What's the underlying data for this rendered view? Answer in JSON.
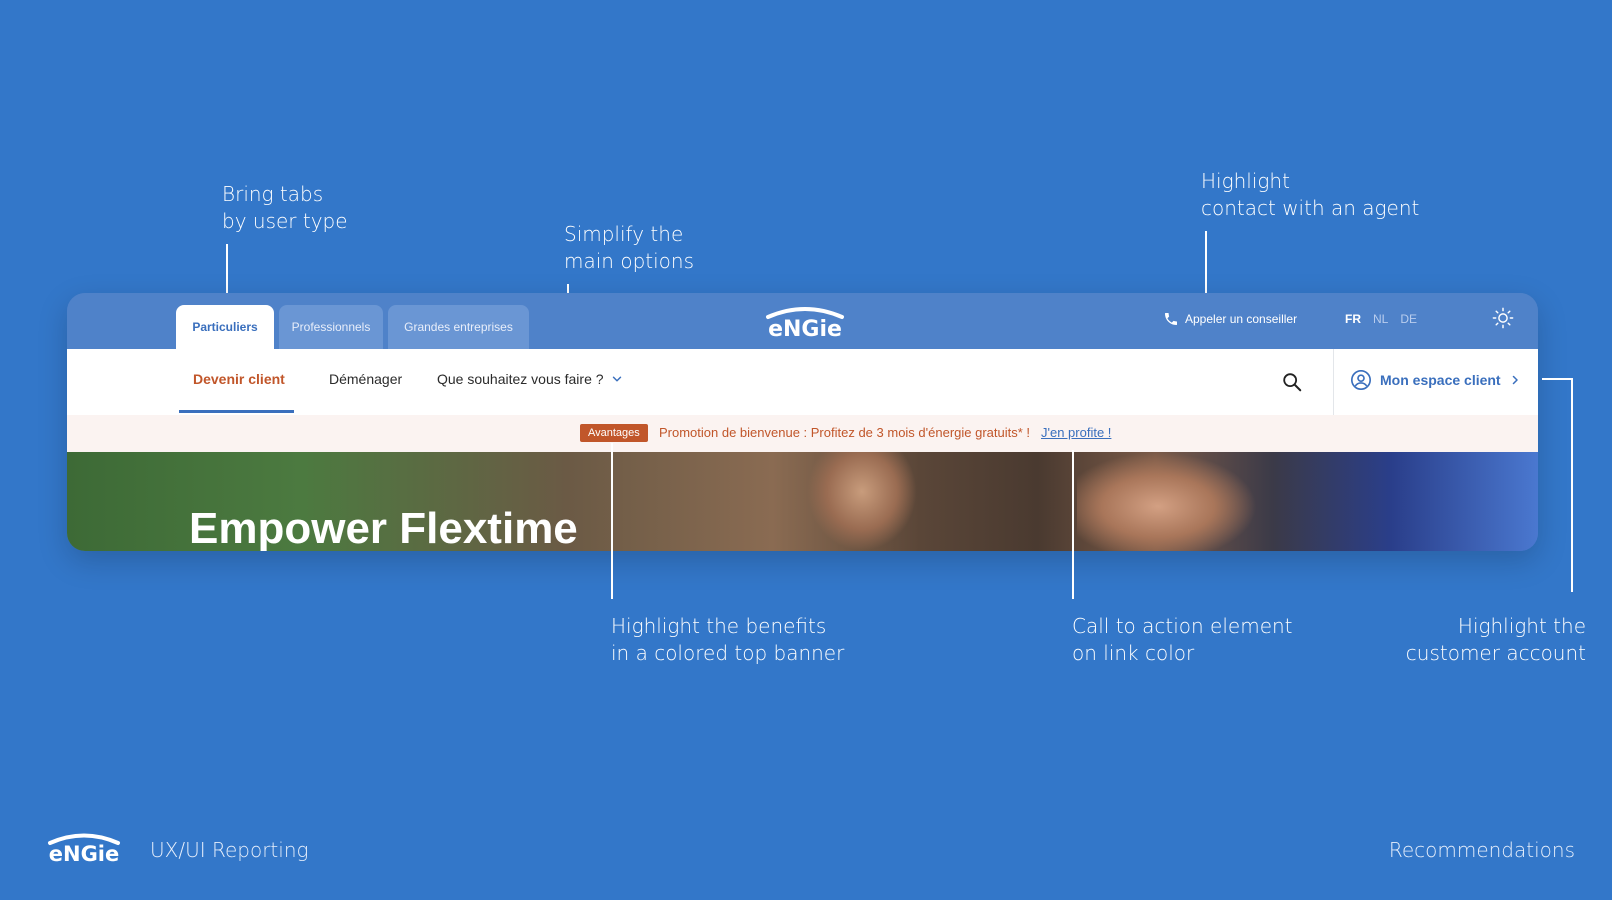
{
  "annotations": {
    "tabs": [
      "Bring tabs",
      "by user type"
    ],
    "options": [
      "Simplify the",
      "main options"
    ],
    "agent": [
      "Highlight",
      "contact with an agent"
    ],
    "benefits": [
      "Highlight the benefits",
      "in a colored top banner"
    ],
    "cta": [
      "Call to action element",
      "on link color"
    ],
    "account": [
      "Highlight the",
      "customer account"
    ]
  },
  "topbar": {
    "user_tabs": [
      "Particuliers",
      "Professionnels",
      "Grandes entreprises"
    ],
    "active_tab": "Particuliers",
    "logo_text": "eNGie",
    "call_label": "Appeler un conseiller",
    "languages": [
      "FR",
      "NL",
      "DE"
    ],
    "active_language": "FR",
    "theme_icon": "sun-icon"
  },
  "navbar": {
    "items": [
      "Devenir client",
      "Déménager",
      "Que souhaitez vous faire ?"
    ],
    "active_item": "Devenir client",
    "account_label": "Mon espace client"
  },
  "promo": {
    "badge": "Avantages",
    "text": "Promotion de bienvenue : Profitez de 3 mois d'énergie gratuits* !",
    "link": "J'en profite !"
  },
  "hero": {
    "title": "Empower Flextime"
  },
  "footer": {
    "logo_text": "eNGie",
    "left": "UX/UI Reporting",
    "right": "Recommendations"
  },
  "colors": {
    "background": "#3377c9",
    "accent_orange": "#c1562a",
    "link_blue": "#3a6fbd"
  }
}
